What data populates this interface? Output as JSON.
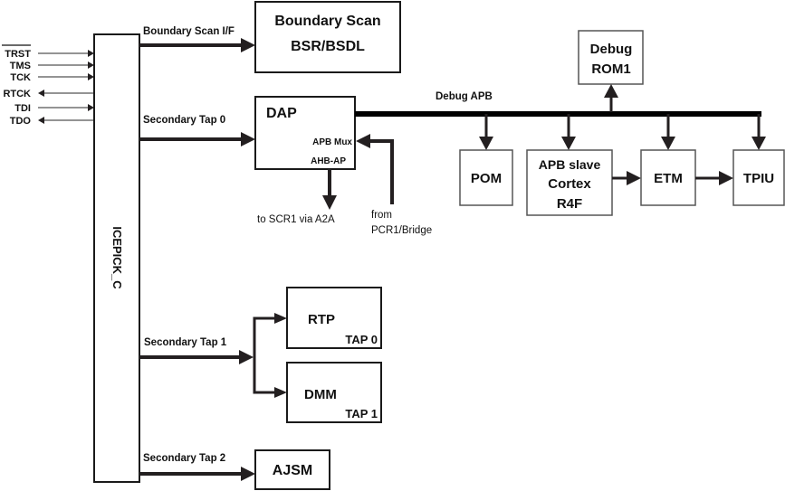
{
  "diagram": {
    "jtag_signals": [
      {
        "name": "TRST",
        "overline": true,
        "direction": "in"
      },
      {
        "name": "TMS",
        "overline": false,
        "direction": "in"
      },
      {
        "name": "TCK",
        "overline": false,
        "direction": "in"
      },
      {
        "name": "RTCK",
        "overline": false,
        "direction": "out"
      },
      {
        "name": "TDI",
        "overline": false,
        "direction": "in"
      },
      {
        "name": "TDO",
        "overline": false,
        "direction": "out"
      }
    ],
    "icepick": {
      "label": "ICEPICK_C"
    },
    "connections": {
      "boundary_scan_if": "Boundary Scan I/F",
      "secondary_tap_0": "Secondary Tap 0",
      "secondary_tap_1": "Secondary Tap 1",
      "secondary_tap_2": "Secondary Tap 2",
      "debug_apb": "Debug APB",
      "to_scr1": "to SCR1 via A2A",
      "from_pcr1_line1": "from",
      "from_pcr1_line2": "PCR1/Bridge"
    },
    "blocks": {
      "boundary_scan": {
        "line1": "Boundary Scan",
        "line2": "BSR/BSDL"
      },
      "dap": {
        "title": "DAP",
        "sub1": "APB Mux",
        "sub2": "AHB-AP"
      },
      "debug_rom": {
        "line1": "Debug",
        "line2": "ROM1"
      },
      "pom": {
        "label": "POM"
      },
      "cortex": {
        "line1": "APB slave",
        "line2": "Cortex",
        "line3": "R4F"
      },
      "etm": {
        "label": "ETM"
      },
      "tpiu": {
        "label": "TPIU"
      },
      "rtp": {
        "label": "RTP",
        "tap": "TAP 0"
      },
      "dmm": {
        "label": "DMM",
        "tap": "TAP 1"
      },
      "ajsm": {
        "label": "AJSM"
      }
    }
  }
}
